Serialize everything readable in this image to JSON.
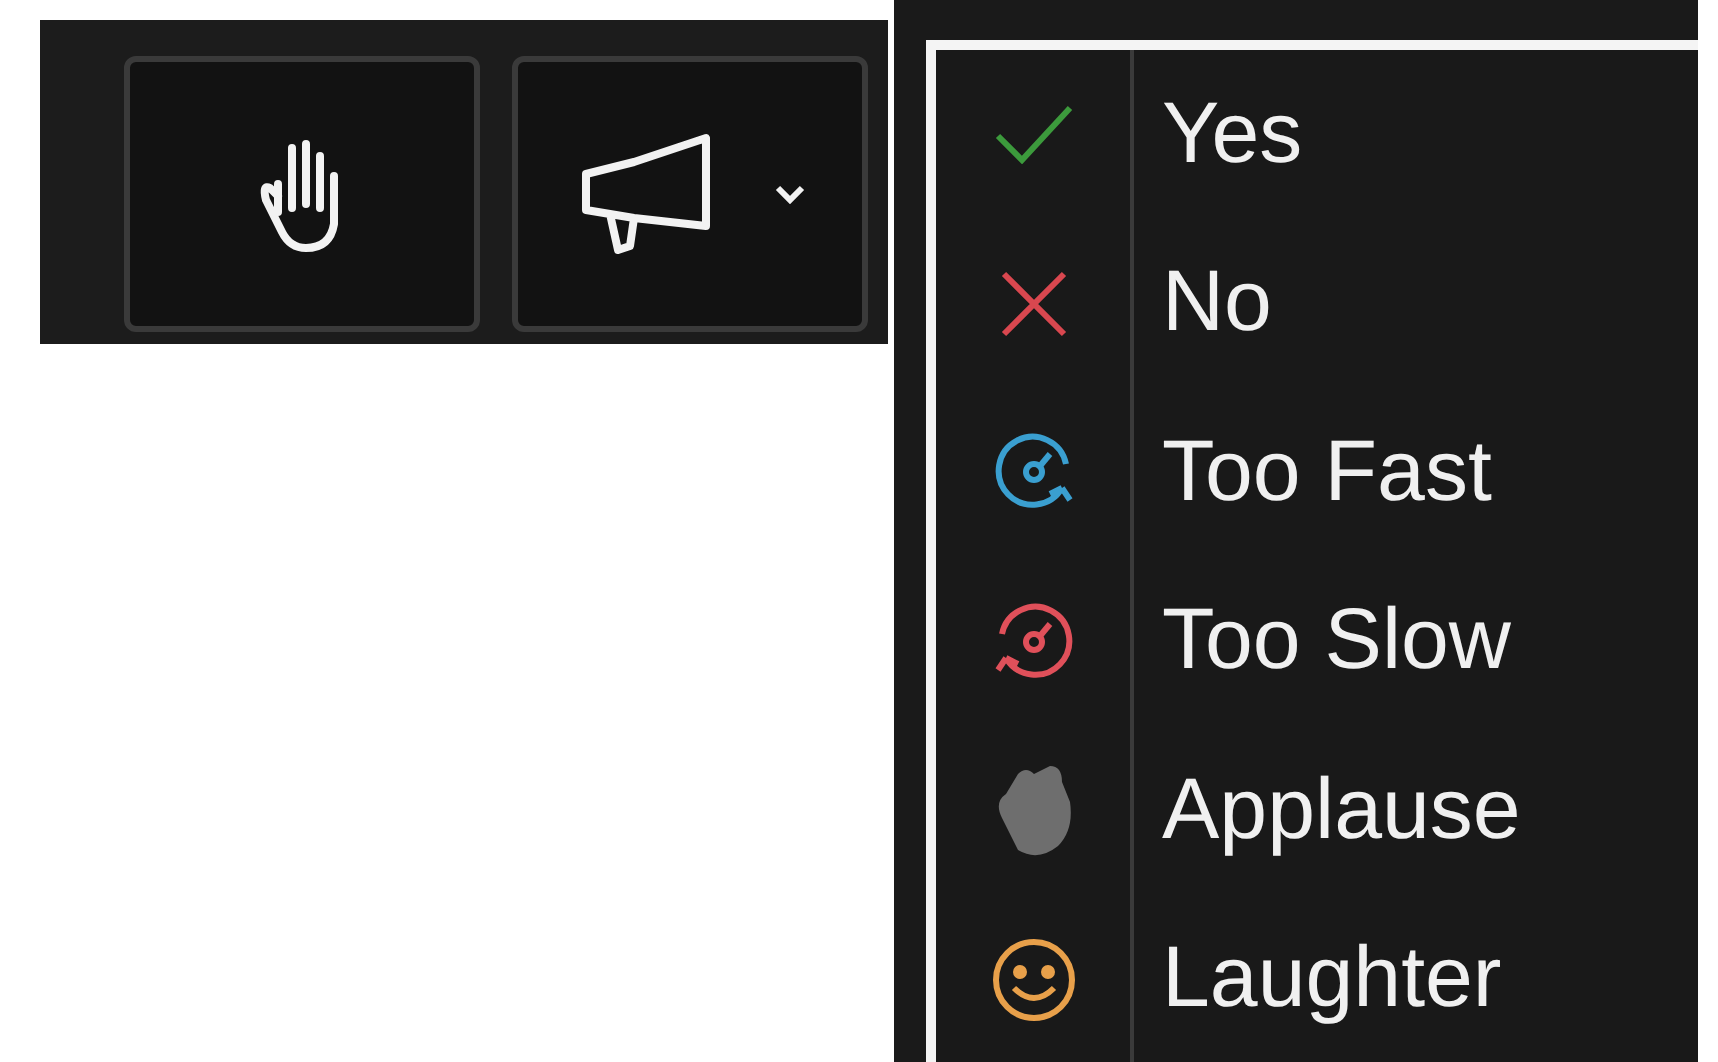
{
  "toolbar": {
    "buttons": [
      {
        "kind": "raise-hand",
        "dropdown": false
      },
      {
        "kind": "megaphone",
        "dropdown": true
      }
    ]
  },
  "reactions_menu": {
    "items": [
      {
        "label": "Yes",
        "kind": "check",
        "color": "#3c9a3c"
      },
      {
        "label": "No",
        "kind": "cross",
        "color": "#d9474f"
      },
      {
        "label": "Too Fast",
        "kind": "fast",
        "color": "#3a9fd0"
      },
      {
        "label": "Too Slow",
        "kind": "slow",
        "color": "#e0505a"
      },
      {
        "label": "Applause",
        "kind": "clap",
        "color": "#6e6e6e"
      },
      {
        "label": "Laughter",
        "kind": "smile",
        "color": "#e8a04a"
      }
    ]
  }
}
